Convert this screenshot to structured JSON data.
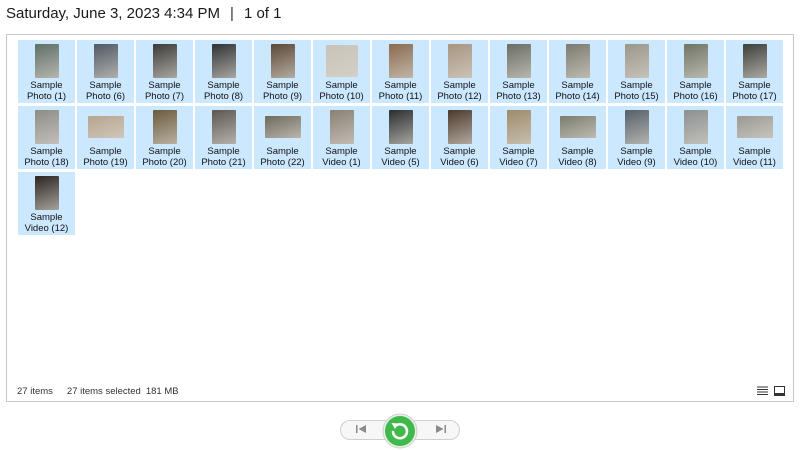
{
  "header": {
    "datetime": "Saturday, June 3, 2023 4:34 PM",
    "separator": "|",
    "page_info": "1 of 1"
  },
  "items": [
    {
      "line1": "Sample",
      "line2": "Photo (1)",
      "shape": "portrait",
      "color": "#5e6f66"
    },
    {
      "line1": "Sample",
      "line2": "Photo (6)",
      "shape": "portrait",
      "color": "#4f5862"
    },
    {
      "line1": "Sample",
      "line2": "Photo (7)",
      "shape": "portrait",
      "color": "#3a3a38"
    },
    {
      "line1": "Sample",
      "line2": "Photo (8)",
      "shape": "portrait",
      "color": "#2f3236"
    },
    {
      "line1": "Sample",
      "line2": "Photo (9)",
      "shape": "portrait",
      "color": "#5b4736"
    },
    {
      "line1": "Sample",
      "line2": "Photo (10)",
      "shape": "square",
      "color": "#c9c3b8"
    },
    {
      "line1": "Sample",
      "line2": "Photo (11)",
      "shape": "portrait",
      "color": "#8a6a4e"
    },
    {
      "line1": "Sample",
      "line2": "Photo (12)",
      "shape": "portrait",
      "color": "#a89580"
    },
    {
      "line1": "Sample",
      "line2": "Photo (13)",
      "shape": "portrait",
      "color": "#6a6d64"
    },
    {
      "line1": "Sample",
      "line2": "Photo (14)",
      "shape": "portrait",
      "color": "#7d7a70"
    },
    {
      "line1": "Sample",
      "line2": "Photo (15)",
      "shape": "portrait",
      "color": "#9a968a"
    },
    {
      "line1": "Sample",
      "line2": "Photo (16)",
      "shape": "portrait",
      "color": "#6f7466"
    },
    {
      "line1": "Sample",
      "line2": "Photo (17)",
      "shape": "portrait",
      "color": "#3c3f3a"
    },
    {
      "line1": "Sample",
      "line2": "Photo (18)",
      "shape": "portrait",
      "color": "#8c8c86"
    },
    {
      "line1": "Sample",
      "line2": "Photo (19)",
      "shape": "landscape",
      "color": "#b6a58e"
    },
    {
      "line1": "Sample",
      "line2": "Photo (20)",
      "shape": "portrait",
      "color": "#6b5a3c"
    },
    {
      "line1": "Sample",
      "line2": "Photo (21)",
      "shape": "portrait",
      "color": "#5d574f"
    },
    {
      "line1": "Sample",
      "line2": "Photo (22)",
      "shape": "landscape",
      "color": "#6e6a5e"
    },
    {
      "line1": "Sample",
      "line2": "Video (1)",
      "shape": "portrait",
      "color": "#8a8074"
    },
    {
      "line1": "Sample",
      "line2": "Video (5)",
      "shape": "portrait",
      "color": "#2a2d30"
    },
    {
      "line1": "Sample",
      "line2": "Video (6)",
      "shape": "portrait",
      "color": "#4b3a2c"
    },
    {
      "line1": "Sample",
      "line2": "Video (7)",
      "shape": "portrait",
      "color": "#9e8a6a"
    },
    {
      "line1": "Sample",
      "line2": "Video (8)",
      "shape": "landscape",
      "color": "#7b7d70"
    },
    {
      "line1": "Sample",
      "line2": "Video (9)",
      "shape": "portrait",
      "color": "#55606a"
    },
    {
      "line1": "Sample",
      "line2": "Video (10)",
      "shape": "portrait",
      "color": "#8a8f90"
    },
    {
      "line1": "Sample",
      "line2": "Video (11)",
      "shape": "landscape",
      "color": "#9a9a92"
    },
    {
      "line1": "Sample",
      "line2": "Video (12)",
      "shape": "portrait",
      "color": "#2b2420"
    }
  ],
  "status": {
    "item_count": "27 items",
    "selected_count": "27 items selected",
    "selected_size": "181 MB"
  },
  "icons": {
    "details_view": "details-view-icon",
    "preview_view": "preview-pane-icon",
    "prev": "skip-previous-icon",
    "next": "skip-next-icon",
    "rotate": "rotate-icon"
  },
  "colors": {
    "selection": "#cce8ff",
    "accent_green": "#3fb94a",
    "border": "#c8c8c8"
  }
}
